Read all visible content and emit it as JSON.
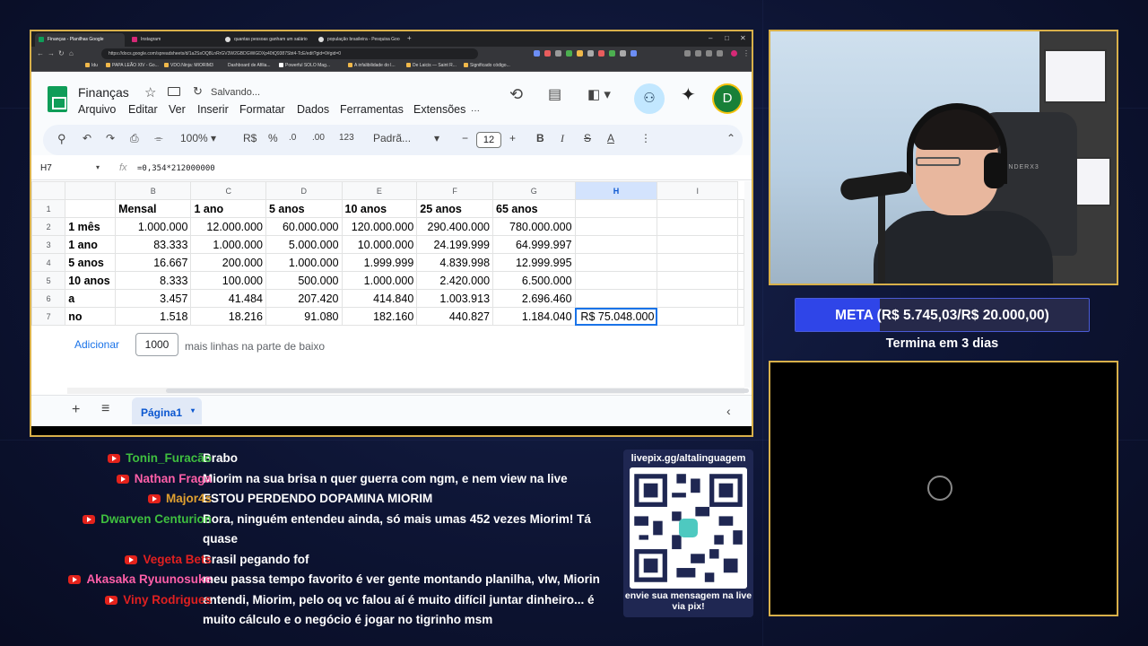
{
  "browser": {
    "tabs": [
      {
        "title": "Finanças - Planilhas Google",
        "active": true
      },
      {
        "title": "Instagram",
        "active": false
      },
      {
        "title": "quantas pessoas ganham um salário",
        "active": false
      },
      {
        "title": "população brasileira - Pesquisa Goo",
        "active": false
      }
    ],
    "url": "https://docs.google.com/spreadsheets/d/1a2SsOQ8LnRrGV3W2GBDGWiGDXp40tQ9387Sbt4-TcE/edit?gid=0#gid=0",
    "bookmarks": [
      "Idu",
      "PAPA LEÃO XIV - Go...",
      "VDO.Ninja: MIORIM3",
      "Dashboard de Afilia...",
      "Powerful SOLO Mag...",
      "A infalibilidade do l...",
      "De Laicis — Saint R...",
      "Significado código..."
    ]
  },
  "sheets": {
    "title": "Finanças",
    "saving": "Salvando...",
    "menu": [
      "Arquivo",
      "Editar",
      "Ver",
      "Inserir",
      "Formatar",
      "Dados",
      "Ferramentas",
      "Extensões"
    ],
    "avatar_letter": "D",
    "toolbar": {
      "zoom": "100%",
      "currency": "R$",
      "percent": "%",
      "dec_less": ".0",
      "dec_more": ".00",
      "number_format": "123",
      "font": "Padrã...",
      "font_size": "12"
    },
    "name_box": "H7",
    "formula": "=0,354*212000000",
    "columns": [
      "B",
      "C",
      "D",
      "E",
      "F",
      "G",
      "H",
      "I"
    ],
    "selected_column": "H",
    "rows": [
      {
        "n": "1",
        "a": "",
        "cells": [
          "Mensal",
          "1 ano",
          "5 anos",
          "10 anos",
          "25 anos",
          "65 anos",
          "",
          ""
        ]
      },
      {
        "n": "2",
        "a": "1 mês",
        "cells": [
          "1.000.000",
          "12.000.000",
          "60.000.000",
          "120.000.000",
          "290.400.000",
          "780.000.000",
          "",
          ""
        ]
      },
      {
        "n": "3",
        "a": "1 ano",
        "cells": [
          "83.333",
          "1.000.000",
          "5.000.000",
          "10.000.000",
          "24.199.999",
          "64.999.997",
          "",
          ""
        ]
      },
      {
        "n": "4",
        "a": "5 anos",
        "cells": [
          "16.667",
          "200.000",
          "1.000.000",
          "1.999.999",
          "4.839.998",
          "12.999.995",
          "",
          ""
        ]
      },
      {
        "n": "5",
        "a": "10 anos",
        "cells": [
          "8.333",
          "100.000",
          "500.000",
          "1.000.000",
          "2.420.000",
          "6.500.000",
          "",
          ""
        ]
      },
      {
        "n": "6",
        "a": "a",
        "cells": [
          "3.457",
          "41.484",
          "207.420",
          "414.840",
          "1.003.913",
          "2.696.460",
          "",
          ""
        ]
      },
      {
        "n": "7",
        "a": "no",
        "cells": [
          "1.518",
          "18.216",
          "91.080",
          "182.160",
          "440.827",
          "1.184.040",
          "R$ 75.048.000",
          ""
        ]
      }
    ],
    "add_rows": {
      "button": "Adicionar",
      "value": "1000",
      "suffix": "mais linhas na parte de baixo"
    },
    "sheet_tab": "Página1"
  },
  "webcam": {
    "chair_brand": "THUNDERX3"
  },
  "goal": {
    "text": "META (R$ 5.745,03/R$ 20.000,00)",
    "progress": 0.287,
    "subtitle": "Termina em 3 dias"
  },
  "chat": [
    {
      "user": "Tonin_Furacão",
      "color": "#3fbf3f",
      "text": "Brabo"
    },
    {
      "user": "Nathan Fraga",
      "color": "#ff5fa8",
      "text": "Miorim na sua brisa n quer guerra com ngm, e nem view na live"
    },
    {
      "user": "Major4s",
      "color": "#e0a030",
      "text": "ESTOU PERDENDO DOPAMINA MIORIM"
    },
    {
      "user": "Dwarven Centurion",
      "color": "#3fbf3f",
      "text": "Bora, ninguém entendeu ainda, só mais umas 452 vezes Miorim! Tá quase"
    },
    {
      "user": "Vegeta Bets",
      "color": "#e02020",
      "text": "Brasil pegando fof"
    },
    {
      "user": "Akasaka Ryuunosuke",
      "color": "#ff5fa8",
      "text": "meu passa tempo favorito é ver gente montando planilha, vlw, Miorin"
    },
    {
      "user": "Viny Rodrigues",
      "color": "#e02020",
      "text": "entendi, Miorim, pelo oq vc falou aí é muito difícil juntar dinheiro... é muito cálculo e o negócio é jogar no tigrinho msm"
    }
  ],
  "qr": {
    "url": "livepix.gg/altalinguagem",
    "caption": "envie sua mensagem na live via pix!"
  }
}
